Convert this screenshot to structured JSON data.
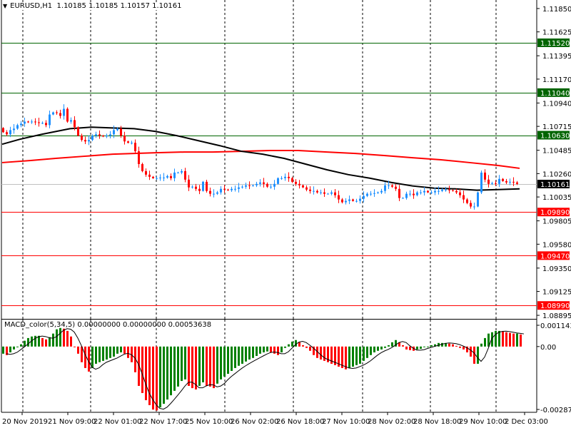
{
  "header": {
    "symbol": "EURUSD,H1",
    "ohlc": "1.10185 1.10185 1.10157 1.10161",
    "collapse_icon": "triangle-down-icon"
  },
  "macd_header": {
    "label": "MACD_color(5,34,5) 0.00000000 0.00000000 0.00053638"
  },
  "colors": {
    "bull": "#1e90ff",
    "bear": "#ff0000",
    "ma_fast": "#000000",
    "ma_slow": "#ff0000",
    "support": "#ff0000",
    "resistance": "#006400",
    "current": "#c0c0c0",
    "macd_up": "#008000",
    "macd_down": "#ff0000"
  },
  "chart_data": [
    {
      "type": "candlestick",
      "title": "EURUSD,H1",
      "ylim": [
        1.08861,
        1.11932
      ],
      "y_ticks": [
        "1.11850",
        "1.11625",
        "1.11395",
        "1.11170",
        "1.10940",
        "1.10715",
        "1.10485",
        "1.10260",
        "1.10035",
        "1.09805",
        "1.09580",
        "1.09350",
        "1.09125",
        "1.08895"
      ],
      "x_ticks": [
        "20 Nov 2019",
        "21 Nov 09:00",
        "22 Nov 01:00",
        "22 Nov 17:00",
        "25 Nov 10:00",
        "26 Nov 02:00",
        "26 Nov 18:00",
        "27 Nov 10:00",
        "28 Nov 02:00",
        "28 Nov 18:00",
        "29 Nov 10:00",
        "2 Dec 03:00"
      ],
      "closes": [
        1.10659,
        1.10638,
        1.10679,
        1.10693,
        1.10727,
        1.10741,
        1.10761,
        1.10754,
        1.10761,
        1.10754,
        1.10748,
        1.10748,
        1.10727,
        1.10829,
        1.1085,
        1.10843,
        1.10816,
        1.10884,
        1.10761,
        1.10775,
        1.10707,
        1.10625,
        1.10584,
        1.1057,
        1.10584,
        1.10625,
        1.10638,
        1.10625,
        1.10618,
        1.10625,
        1.10638,
        1.10679,
        1.10693,
        1.10625,
        1.1057,
        1.10557,
        1.10557,
        1.10475,
        1.10352,
        1.10284,
        1.1025,
        1.10229,
        1.10216,
        1.10216,
        1.10222,
        1.10222,
        1.10236,
        1.10216,
        1.1027,
        1.1027,
        1.10284,
        1.10202,
        1.10127,
        1.10134,
        1.10113,
        1.10093,
        1.10181,
        1.10093,
        1.10066,
        1.10066,
        1.10079,
        1.10113,
        1.10106,
        1.101,
        1.10113,
        1.10113,
        1.10127,
        1.10134,
        1.10147,
        1.10141,
        1.10147,
        1.10161,
        1.10175,
        1.10161,
        1.10134,
        1.10134,
        1.10161,
        1.10216,
        1.10216,
        1.10229,
        1.10216,
        1.10181,
        1.10161,
        1.10147,
        1.10127,
        1.10106,
        1.10093,
        1.10093,
        1.10079,
        1.10079,
        1.10066,
        1.10066,
        1.10079,
        1.10052,
        1.10011,
        1.09984,
        1.09997,
        1.10011,
        1.09997,
        1.09997,
        1.10018,
        1.10045,
        1.10066,
        1.10066,
        1.10072,
        1.10079,
        1.10093,
        1.10147,
        1.10147,
        1.10134,
        1.10113,
        1.10025,
        1.10025,
        1.10066,
        1.10066,
        1.10052,
        1.10079,
        1.10079,
        1.10093,
        1.10079,
        1.10079,
        1.10093,
        1.10093,
        1.10106,
        1.10106,
        1.101,
        1.10093,
        1.10079,
        1.10052,
        1.10011,
        1.09977,
        1.09943,
        1.09943,
        1.10079,
        1.1027,
        1.10202,
        1.10161,
        1.10168,
        1.10161,
        1.10209,
        1.10188,
        1.10175,
        1.10181,
        1.10175,
        1.10161
      ],
      "ma_fast": [
        [
          0,
          1.10543
        ],
        [
          5,
          1.10591
        ],
        [
          11,
          1.10638
        ],
        [
          19,
          1.10693
        ],
        [
          25,
          1.10707
        ],
        [
          31,
          1.107
        ],
        [
          37,
          1.10693
        ],
        [
          43,
          1.10666
        ],
        [
          49,
          1.10625
        ],
        [
          55,
          1.10577
        ],
        [
          61,
          1.10529
        ],
        [
          67,
          1.10475
        ],
        [
          73,
          1.10447
        ],
        [
          79,
          1.10407
        ],
        [
          85,
          1.10352
        ],
        [
          91,
          1.10297
        ],
        [
          97,
          1.1025
        ],
        [
          103,
          1.10216
        ],
        [
          109,
          1.10175
        ],
        [
          115,
          1.10141
        ],
        [
          121,
          1.1012
        ],
        [
          127,
          1.10113
        ],
        [
          133,
          1.101
        ],
        [
          139,
          1.10106
        ],
        [
          145,
          1.10113
        ]
      ],
      "ma_slow": [
        [
          0,
          1.10366
        ],
        [
          8,
          1.10386
        ],
        [
          15,
          1.10407
        ],
        [
          23,
          1.10427
        ],
        [
          31,
          1.10447
        ],
        [
          37,
          1.10454
        ],
        [
          43,
          1.10461
        ],
        [
          51,
          1.10468
        ],
        [
          59,
          1.10468
        ],
        [
          67,
          1.10475
        ],
        [
          75,
          1.10482
        ],
        [
          83,
          1.10482
        ],
        [
          91,
          1.10468
        ],
        [
          99,
          1.10454
        ],
        [
          107,
          1.10434
        ],
        [
          115,
          1.10413
        ],
        [
          123,
          1.10393
        ],
        [
          131,
          1.10366
        ],
        [
          139,
          1.10338
        ],
        [
          145,
          1.10311
        ]
      ],
      "levels": [
        {
          "price": "1.11520",
          "kind": "resistance"
        },
        {
          "price": "1.11040",
          "kind": "resistance"
        },
        {
          "price": "1.10630",
          "kind": "resistance"
        },
        {
          "price": "1.09890",
          "kind": "support"
        },
        {
          "price": "1.09470",
          "kind": "support"
        },
        {
          "price": "1.08990",
          "kind": "support"
        }
      ],
      "current_price": "1.10161"
    },
    {
      "type": "bar",
      "title": "MACD_color(5,34,5)",
      "ylim": [
        -0.002878,
        0.0011432
      ],
      "y_ticks": [
        "0.0011432",
        "0.00",
        "-0.002878"
      ],
      "values": [
        -0.00032,
        -0.00038,
        -0.00026,
        -0.00013,
        -3e-05,
        0.0001,
        0.00026,
        0.00038,
        0.00045,
        0.00048,
        0.00048,
        0.00038,
        0.00032,
        0.00042,
        0.00058,
        0.00077,
        0.00083,
        0.0008,
        0.0007,
        0.00045,
        0,
        -0.00032,
        -0.0007,
        -0.00096,
        -0.00112,
        -0.00096,
        -0.00077,
        -0.0007,
        -0.00064,
        -0.00058,
        -0.00051,
        -0.00045,
        -0.00032,
        -0.00026,
        -0.00032,
        -0.00051,
        -0.0007,
        -0.00115,
        -0.00176,
        -0.00208,
        -0.0024,
        -0.00262,
        -0.00282,
        -0.00286,
        -0.00272,
        -0.00256,
        -0.00237,
        -0.00218,
        -0.00198,
        -0.00179,
        -0.00154,
        -0.00147,
        -0.00176,
        -0.00186,
        -0.00192,
        -0.00176,
        -0.0016,
        -0.00176,
        -0.00179,
        -0.00186,
        -0.00166,
        -0.00147,
        -0.00134,
        -0.00122,
        -0.00109,
        -0.00096,
        -0.00086,
        -0.00077,
        -0.00067,
        -0.00058,
        -0.00051,
        -0.00042,
        -0.00032,
        -0.00026,
        -0.00022,
        -0.00026,
        -0.00032,
        -0.00038,
        -0.00026,
        -6e-05,
        0.0001,
        0.00022,
        0.00029,
        0.00019,
        6e-05,
        -6e-05,
        -0.00019,
        -0.00038,
        -0.00051,
        -0.00058,
        -0.00064,
        -0.0007,
        -0.00077,
        -0.00083,
        -0.0009,
        -0.00096,
        -0.00102,
        -0.00096,
        -0.0009,
        -0.00083,
        -0.00077,
        -0.00064,
        -0.00051,
        -0.00038,
        -0.00026,
        -0.00019,
        -0.00013,
        -6e-05,
        6e-05,
        0.00019,
        0.00029,
        0.00019,
        6e-05,
        -0.00013,
        -0.00016,
        -0.00019,
        -0.00013,
        -0.0001,
        -3e-05,
        0,
        6e-05,
        0.0001,
        0.00016,
        0.00016,
        0.00016,
        0.00013,
        0.0001,
        3e-05,
        -6e-05,
        -0.00013,
        -0.00026,
        -0.00045,
        -0.00077,
        -0.00077,
        0.00013,
        0.00038,
        0.00058,
        0.00064,
        0.0007,
        0.0007,
        0.00067,
        0.00064,
        0.00061,
        0.00058,
        0.00058,
        0.00054
      ]
    }
  ]
}
